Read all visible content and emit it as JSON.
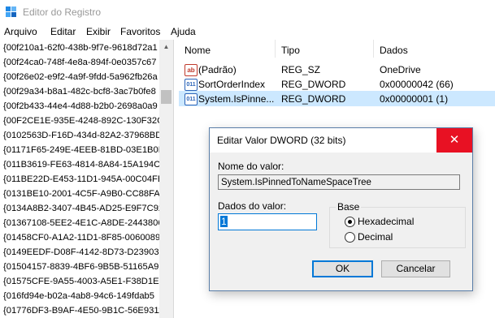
{
  "window": {
    "title": "Editor do Registro"
  },
  "menu": [
    "Arquivo",
    "Editar",
    "Exibir",
    "Favoritos",
    "Ajuda"
  ],
  "tree": [
    "{00f210a1-62f0-438b-9f7e-9618d72a1",
    "{00f24ca0-748f-4e8a-894f-0e0357c67",
    "{00f26e02-e9f2-4a9f-9fdd-5a962fb26a",
    "{00f29a34-b8a1-482c-bcf8-3ac7b0fe8",
    "{00f2b433-44e4-4d88-b2b0-2698a0a9",
    "{00F2CE1E-935E-4248-892C-130F32C4",
    "{0102563D-F16D-434d-82A2-37968BD",
    "{01171F65-249E-4EEB-81BD-03E1B0FA",
    "{011B3619-FE63-4814-8A84-15A194C",
    "{011BE22D-E453-11D1-945A-00C04FE",
    "{0131BE10-2001-4C5F-A9B0-CC88FAI",
    "{0134A8B2-3407-4B45-AD25-E9F7C92",
    "{01367108-5EE2-4E1C-A8DE-2443806",
    "{01458CF0-A1A2-11D1-8F85-0060089",
    "{0149EEDF-D08F-4142-8D73-D23903D",
    "{01504157-8839-4BF6-9B5B-51165A9",
    "{01575CFE-9A55-4003-A5E1-F38D1EE",
    "{016fd94e-b02a-4ab8-94c6-149fdab5",
    "{01776DF3-B9AF-4E50-9B1C-56E9311"
  ],
  "list": {
    "headers": {
      "name": "Nome",
      "type": "Tipo",
      "data": "Dados"
    },
    "rows": [
      {
        "icon": "ab",
        "name": "(Padrão)",
        "type": "REG_SZ",
        "data": "OneDrive"
      },
      {
        "icon": "011",
        "name": "SortOrderIndex",
        "type": "REG_DWORD",
        "data": "0x00000042 (66)"
      },
      {
        "icon": "011",
        "name": "System.IsPinne...",
        "type": "REG_DWORD",
        "data": "0x00000001 (1)"
      }
    ]
  },
  "dialog": {
    "title": "Editar Valor DWORD (32 bits)",
    "close_glyph": "✕",
    "name_label": "Nome do valor:",
    "name_value": "System.IsPinnedToNameSpaceTree",
    "data_label": "Dados do valor:",
    "data_value": "1",
    "base_label": "Base",
    "hex_label": "Hexadecimal",
    "dec_label": "Decimal",
    "ok_label": "OK",
    "cancel_label": "Cancelar"
  },
  "colors": {
    "close_red": "#e81123",
    "selection": "#cce8ff",
    "accent": "#0078d7"
  }
}
